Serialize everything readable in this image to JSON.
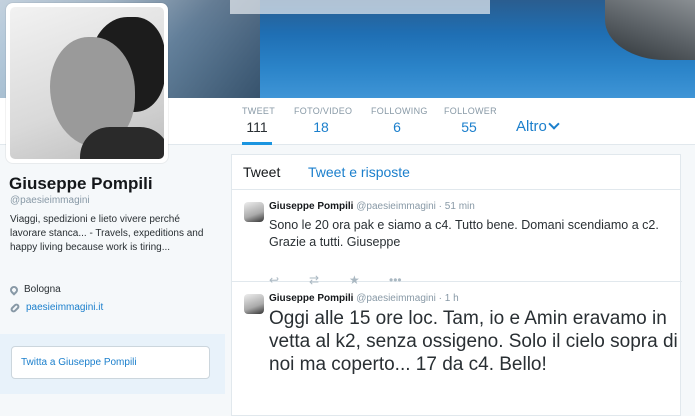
{
  "profile": {
    "name": "Giuseppe Pompili",
    "handle": "@paesieimmagini",
    "bio": "Viaggi, spedizioni e lieto vivere perché lavorare stanca... - Travels, expeditions and happy living because work is tiring...",
    "location": "Bologna",
    "website": "paesieimmagini.it",
    "tweet_to_label": "Twitta a Giuseppe Pompili"
  },
  "nav": {
    "stats": [
      {
        "label": "TWEET",
        "value": "111"
      },
      {
        "label": "FOTO/VIDEO",
        "value": "18"
      },
      {
        "label": "FOLLOWING",
        "value": "6"
      },
      {
        "label": "FOLLOWER",
        "value": "55"
      }
    ],
    "more_label": "Altro"
  },
  "timeline": {
    "tabs": [
      "Tweet",
      "Tweet e risposte"
    ],
    "tweets": [
      {
        "name": "Giuseppe Pompili",
        "handle": "@paesieimmagini",
        "time": "51 min",
        "text": "Sono le 20 ora pak e siamo a c4. Tutto bene. Domani scendiamo a c2. Grazie a tutti. Giuseppe"
      },
      {
        "name": "Giuseppe Pompili",
        "handle": "@paesieimmagini",
        "time": "1 h",
        "text": "Oggi alle 15 ore loc. Tam, io e Amin eravamo in vetta al k2, senza ossigeno. Solo il cielo sopra di noi ma coperto... 17 da c4. Bello!"
      }
    ]
  },
  "icons": {
    "reply": "reply-icon",
    "retweet": "retweet-icon",
    "favorite": "star-icon",
    "more": "more-icon",
    "location": "location-pin-icon",
    "link": "link-icon",
    "chevron": "chevron-down-icon"
  },
  "colors": {
    "accent": "#1b95e0",
    "link": "#1b7fcc",
    "muted": "#8899a6"
  }
}
